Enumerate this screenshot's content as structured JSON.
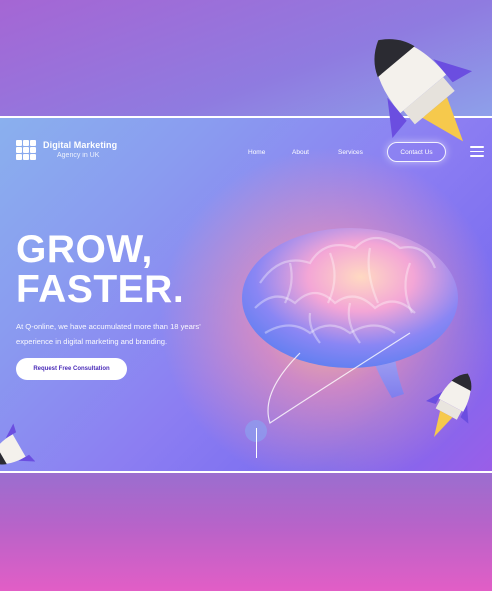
{
  "header": {
    "brand": "Digital Marketing",
    "tagline": "Agency in UK"
  },
  "nav": {
    "items": [
      "Home",
      "About",
      "Services"
    ],
    "contact_label": "Contact Us"
  },
  "hero": {
    "headline_line1": "GROW,",
    "headline_line2": "FASTER.",
    "description": "At Q-online, we have accumulated more than 18 years' experience in digital marketing and branding.",
    "cta_label": "Request Free Consultation"
  },
  "icons": [
    "logo-grid-icon",
    "hamburger-menu-icon",
    "brain-illustration",
    "rocket-icon",
    "scroll-indicator-icon"
  ],
  "colors": {
    "accent": "#4a2bb8",
    "white": "#ffffff",
    "purple": "#8c7ef2",
    "pink": "#e05fc6"
  }
}
